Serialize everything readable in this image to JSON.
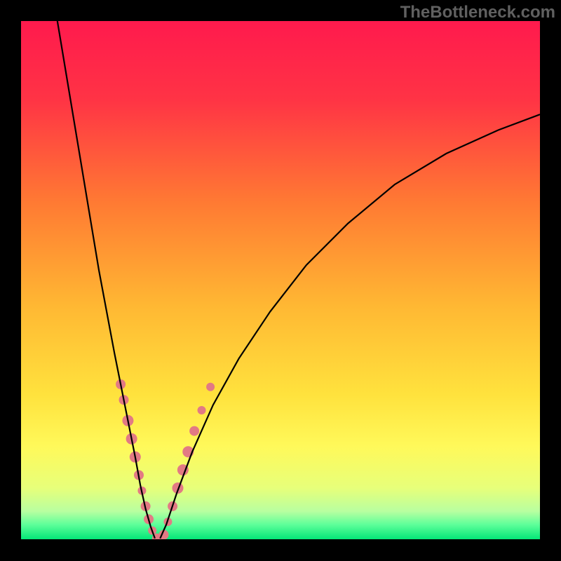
{
  "watermark": "TheBottleneck.com",
  "chart_data": {
    "type": "line",
    "title": "",
    "xlabel": "",
    "ylabel": "",
    "xlim": [
      0,
      100
    ],
    "ylim": [
      0,
      100
    ],
    "background_gradient": {
      "type": "vertical",
      "stops": [
        {
          "pos": 0.0,
          "color": "#ff1a4d"
        },
        {
          "pos": 0.15,
          "color": "#ff3345"
        },
        {
          "pos": 0.35,
          "color": "#ff7a33"
        },
        {
          "pos": 0.55,
          "color": "#ffb833"
        },
        {
          "pos": 0.72,
          "color": "#ffe23d"
        },
        {
          "pos": 0.82,
          "color": "#fff95a"
        },
        {
          "pos": 0.9,
          "color": "#e7ff7a"
        },
        {
          "pos": 0.945,
          "color": "#b8ffa0"
        },
        {
          "pos": 0.97,
          "color": "#5fff9a"
        },
        {
          "pos": 1.0,
          "color": "#00e676"
        }
      ]
    },
    "series": [
      {
        "name": "left-branch",
        "x": [
          7.0,
          9.0,
          11.0,
          13.0,
          15.0,
          16.5,
          18.0,
          19.5,
          20.8,
          22.0,
          23.0,
          24.0,
          25.0,
          25.8
        ],
        "y": [
          100.0,
          88.0,
          76.0,
          64.0,
          52.0,
          44.0,
          36.0,
          28.5,
          22.0,
          16.0,
          10.5,
          6.0,
          2.5,
          0.3
        ]
      },
      {
        "name": "right-branch",
        "x": [
          26.8,
          28.0,
          30.0,
          33.0,
          37.0,
          42.0,
          48.0,
          55.0,
          63.0,
          72.0,
          82.0,
          92.0,
          100.0
        ],
        "y": [
          0.3,
          3.0,
          9.0,
          17.0,
          26.0,
          35.0,
          44.0,
          53.0,
          61.0,
          68.5,
          74.5,
          79.0,
          82.0
        ]
      }
    ],
    "floor_line": {
      "y": 0.0
    },
    "dots": {
      "color": "#e27a84",
      "radius_small": 5,
      "radius_large": 8,
      "points": [
        {
          "x": 19.2,
          "y": 30.0,
          "r": 7
        },
        {
          "x": 19.8,
          "y": 27.0,
          "r": 7
        },
        {
          "x": 20.6,
          "y": 23.0,
          "r": 8
        },
        {
          "x": 21.3,
          "y": 19.5,
          "r": 8
        },
        {
          "x": 22.0,
          "y": 16.0,
          "r": 8
        },
        {
          "x": 22.7,
          "y": 12.5,
          "r": 7
        },
        {
          "x": 23.3,
          "y": 9.5,
          "r": 6
        },
        {
          "x": 24.0,
          "y": 6.5,
          "r": 7
        },
        {
          "x": 24.6,
          "y": 4.0,
          "r": 7
        },
        {
          "x": 25.3,
          "y": 1.8,
          "r": 6
        },
        {
          "x": 26.2,
          "y": 0.3,
          "r": 7
        },
        {
          "x": 27.5,
          "y": 1.0,
          "r": 7
        },
        {
          "x": 28.3,
          "y": 3.5,
          "r": 6
        },
        {
          "x": 29.2,
          "y": 6.5,
          "r": 7
        },
        {
          "x": 30.2,
          "y": 10.0,
          "r": 8
        },
        {
          "x": 31.2,
          "y": 13.5,
          "r": 8
        },
        {
          "x": 32.2,
          "y": 17.0,
          "r": 8
        },
        {
          "x": 33.4,
          "y": 21.0,
          "r": 7
        },
        {
          "x": 34.8,
          "y": 25.0,
          "r": 6
        },
        {
          "x": 36.5,
          "y": 29.5,
          "r": 6
        }
      ]
    }
  }
}
